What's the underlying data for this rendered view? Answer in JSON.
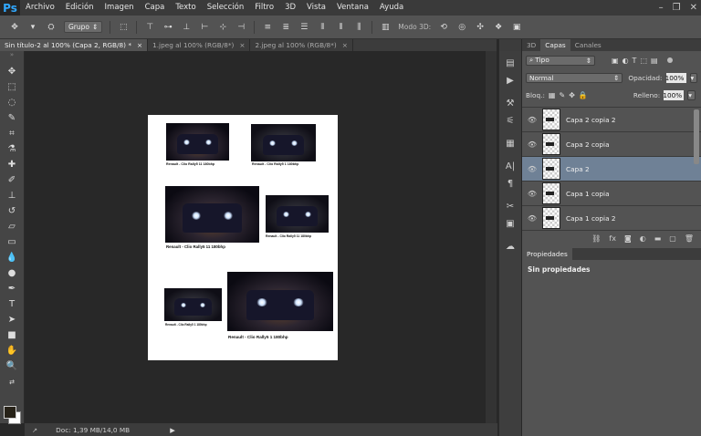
{
  "app": {
    "logo": "Ps"
  },
  "menu": [
    "Archivo",
    "Edición",
    "Imagen",
    "Capa",
    "Texto",
    "Selección",
    "Filtro",
    "3D",
    "Vista",
    "Ventana",
    "Ayuda"
  ],
  "window_controls": [
    "minimize-icon",
    "restore-icon",
    "close-icon"
  ],
  "options": {
    "group_select": "Grupo",
    "mode_3d_label": "Modo 3D:"
  },
  "tabs": [
    {
      "label": "Sin título-2 al 100% (Capa 2, RGB/8) *",
      "close": "×",
      "active": true
    },
    {
      "label": "1.jpeg al 100% (RGB/8*)",
      "close": "×",
      "active": false
    },
    {
      "label": "2.jpeg al 100% (RGB/8*)",
      "close": "×",
      "active": false
    }
  ],
  "captions": {
    "c1": "Renault - Clio Rally5         11          180bhp",
    "c2": "Renault - Clio Rally5     1          180bhp",
    "c3": "Renault - Clio Rally5          11          180bhp",
    "c4": "Renault - Clio Rally5     11     180bhp",
    "c5": "Renault - Clio Rally5     1     180bhp",
    "c6": "Renault - Clio Rally5          1               180bhp"
  },
  "status": {
    "doc": "Doc: 1,39 MB/14,0 MB"
  },
  "panel": {
    "tabs": [
      "3D",
      "Capas",
      "Canales"
    ],
    "filter": "Tipo",
    "blend_mode": "Normal",
    "opacity_label": "Opacidad:",
    "opacity_value": "100%",
    "lock_label": "Bloq.:",
    "fill_label": "Relleno:",
    "fill_value": "100%",
    "layers": [
      {
        "name": "Capa 2 copia 2",
        "selected": false
      },
      {
        "name": "Capa 2 copia",
        "selected": false
      },
      {
        "name": "Capa 2",
        "selected": true
      },
      {
        "name": "Capa 1 copia",
        "selected": false
      },
      {
        "name": "Capa 1 copia 2",
        "selected": false
      }
    ]
  },
  "properties": {
    "tab": "Propiedades",
    "text": "Sin propiedades"
  },
  "colors": {
    "accent": "#31a8ff",
    "selected_layer": "#6f8196",
    "panel_bg": "#535353"
  }
}
